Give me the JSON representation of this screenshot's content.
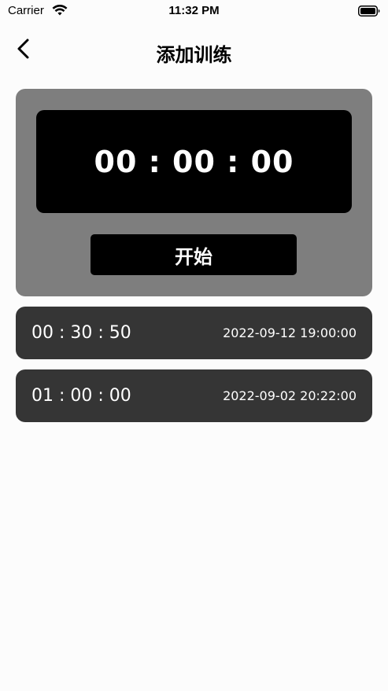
{
  "status_bar": {
    "carrier": "Carrier",
    "time": "11:32 PM"
  },
  "nav": {
    "title": "添加训练"
  },
  "timer": {
    "display": "00 : 00 : 00",
    "start_label": "开始"
  },
  "records": [
    {
      "duration": "00 : 30 : 50",
      "date": "2022-09-12 19:00:00"
    },
    {
      "duration": "01 : 00 : 00",
      "date": "2022-09-02 20:22:00"
    }
  ],
  "colors": {
    "card_bg": "#7e7e7e",
    "record_bg": "#353535",
    "display_bg": "#000000"
  },
  "icons": {
    "wifi": "wifi-icon",
    "battery": "battery-icon",
    "back": "chevron-left-icon"
  }
}
